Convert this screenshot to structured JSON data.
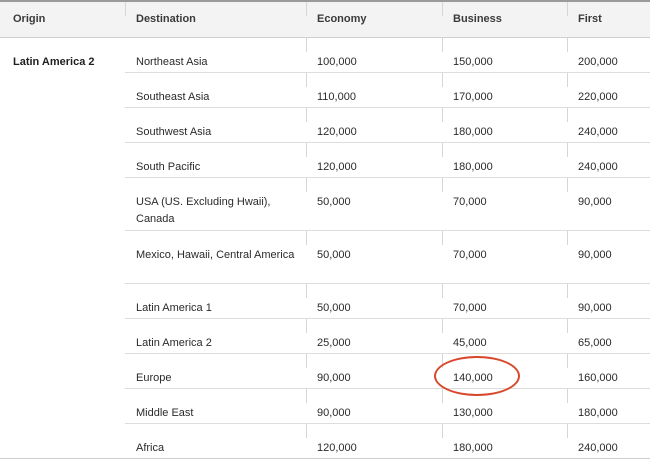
{
  "table": {
    "headers": {
      "origin": "Origin",
      "destination": "Destination",
      "economy": "Economy",
      "business": "Business",
      "first": "First"
    },
    "origin": "Latin America 2",
    "rows": [
      {
        "destination": "Northeast Asia",
        "economy": "100,000",
        "business": "150,000",
        "first": "200,000"
      },
      {
        "destination": "Southeast Asia",
        "economy": "110,000",
        "business": "170,000",
        "first": "220,000"
      },
      {
        "destination": "Southwest Asia",
        "economy": "120,000",
        "business": "180,000",
        "first": "240,000"
      },
      {
        "destination": "South Pacific",
        "economy": "120,000",
        "business": "180,000",
        "first": "240,000"
      },
      {
        "destination": "USA (US. Excluding Hwaii), Canada",
        "economy": "50,000",
        "business": "70,000",
        "first": "90,000"
      },
      {
        "destination": "Mexico, Hawaii, Central America",
        "economy": "50,000",
        "business": "70,000",
        "first": "90,000"
      },
      {
        "destination": "Latin America 1",
        "economy": "50,000",
        "business": "70,000",
        "first": "90,000"
      },
      {
        "destination": "Latin America 2",
        "economy": "25,000",
        "business": "45,000",
        "first": "65,000"
      },
      {
        "destination": "Europe",
        "economy": "90,000",
        "business": "140,000",
        "first": "160,000"
      },
      {
        "destination": "Middle East",
        "economy": "90,000",
        "business": "130,000",
        "first": "180,000"
      },
      {
        "destination": "Africa",
        "economy": "120,000",
        "business": "180,000",
        "first": "240,000"
      }
    ]
  },
  "annotation": {
    "ring_color": "#d9472b"
  }
}
